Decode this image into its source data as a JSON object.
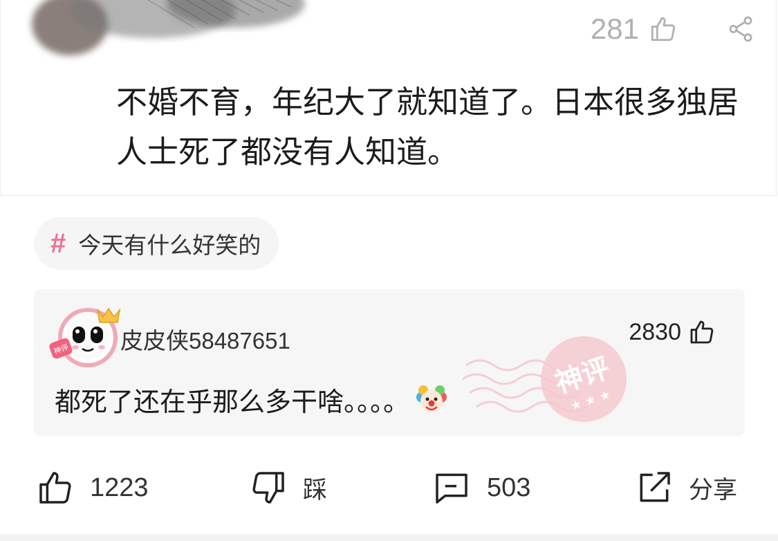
{
  "post": {
    "like_count": "281",
    "text": "不婚不育，年纪大了就知道了。日本很多独居人士死了都没有人知道。"
  },
  "topic": {
    "hash": "#",
    "label": "今天有什么好笑的"
  },
  "hot_comment": {
    "username": "皮皮侠58487651",
    "like_count": "2830",
    "text": "都死了还在乎那么多干啥。。。。",
    "badge_text": "神评",
    "avatar_tag": "神评"
  },
  "actions": {
    "like_count": "1223",
    "dislike_label": "踩",
    "comment_count": "503",
    "share_label": "分享"
  },
  "colors": {
    "accent_pink": "#ef6f8f",
    "icon_gray": "#b0b0b0",
    "text_dark": "#1c1c1c"
  }
}
